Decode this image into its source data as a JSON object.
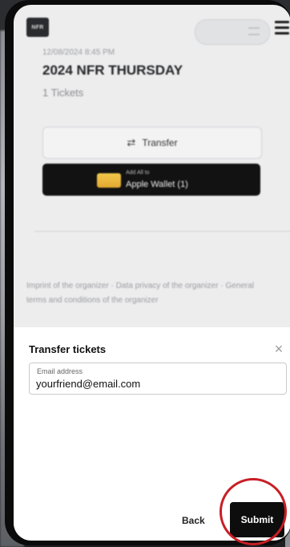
{
  "app": {
    "logo_text": "NFR"
  },
  "event": {
    "date": "12/08/2024 8:45 PM",
    "title": "2024 NFR THURSDAY",
    "ticket_count": "1 Tickets"
  },
  "actions": {
    "transfer_label": "Transfer",
    "wallet_small": "Add All to",
    "wallet_label": "Apple Wallet (1)"
  },
  "footer": {
    "text": "Imprint of the organizer · Data privacy of the organizer · General terms and conditions of the organizer"
  },
  "transfer_sheet": {
    "title": "Transfer tickets",
    "email_label": "Email address",
    "email_value": "yourfriend@email.com",
    "back_label": "Back",
    "submit_label": "Submit"
  },
  "colors": {
    "annotation_circle": "#c81e26",
    "submit_bg": "#0d0d0d"
  }
}
